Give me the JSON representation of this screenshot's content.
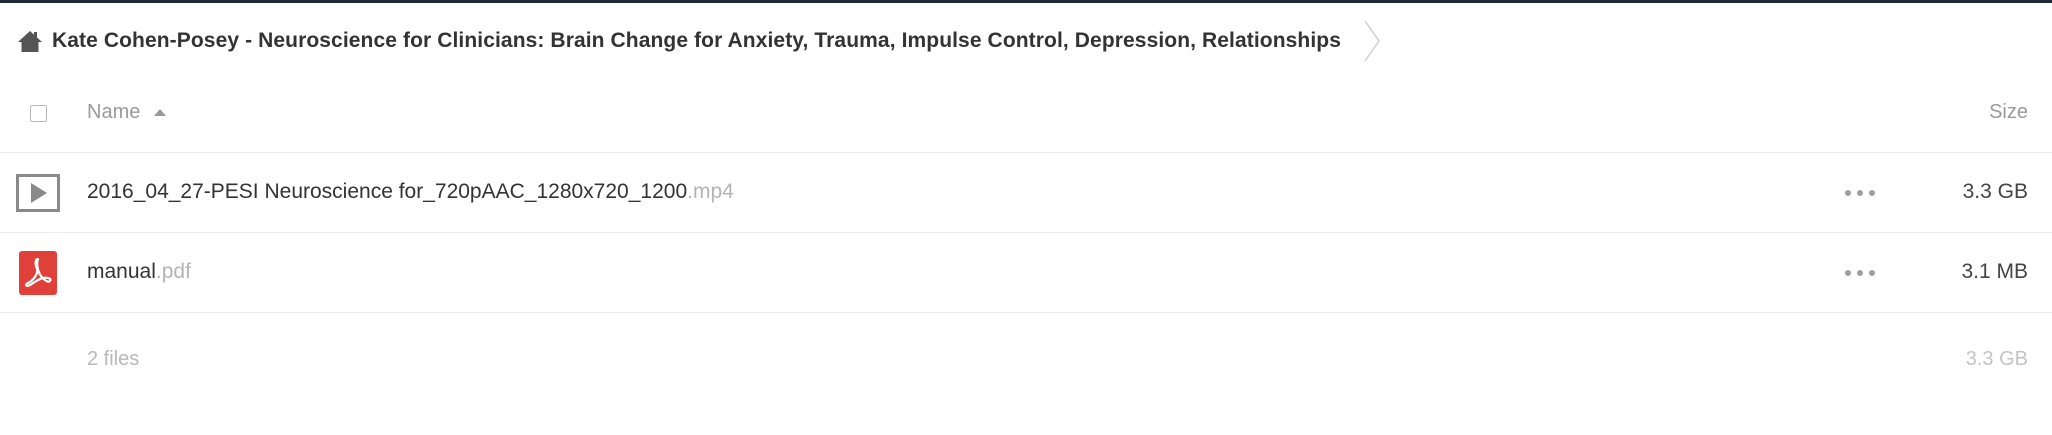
{
  "breadcrumb": {
    "home_icon": "home-icon",
    "folder_label": "Kate Cohen-Posey - Neuroscience for Clinicians: Brain Change for Anxiety, Trauma, Impulse Control, Depression, Relationships"
  },
  "table": {
    "headers": {
      "name": "Name",
      "size": "Size",
      "sort_direction": "ascending"
    },
    "files": [
      {
        "icon": "video-play-icon",
        "base_name": "2016_04_27-PESI Neuroscience for_720pAAC_1280x720_1200",
        "extension": ".mp4",
        "size": "3.3 GB"
      },
      {
        "icon": "pdf-icon",
        "base_name": "manual",
        "extension": ".pdf",
        "size": "3.1 MB"
      }
    ],
    "footer": {
      "count": "2 files",
      "total_size": "3.3 GB"
    }
  },
  "colors": {
    "top_border": "#1e2a38",
    "pdf_red": "#e0403a",
    "video_icon_gray": "#8a8a8a",
    "muted_text": "#9a9a9a"
  }
}
